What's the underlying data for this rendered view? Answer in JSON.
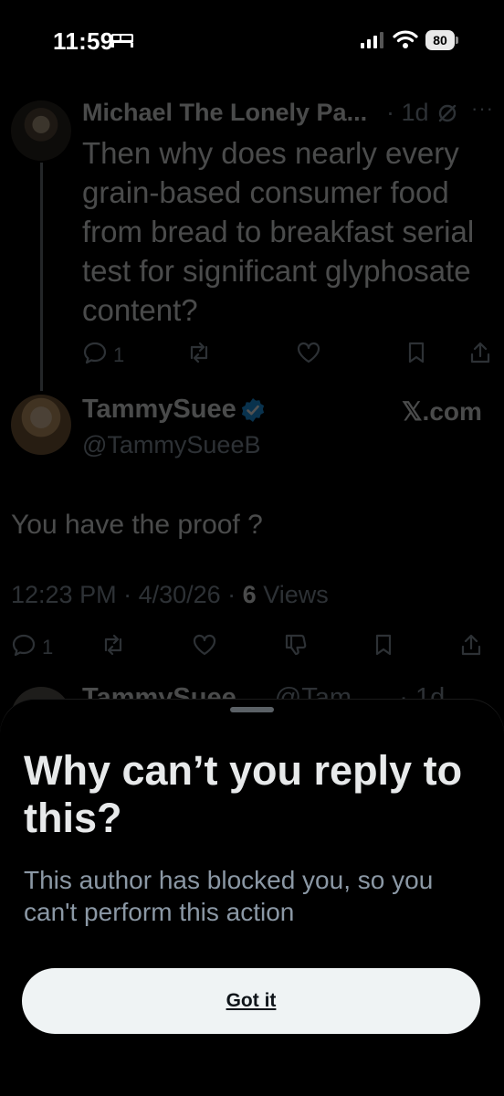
{
  "status_bar": {
    "time": "11:59",
    "battery": "80",
    "icons": [
      "bed-icon",
      "cellular-signal-icon",
      "wifi-icon",
      "battery-icon"
    ]
  },
  "parent_tweet": {
    "author": "Michael The Lonely Pa...",
    "meta": "· 1d",
    "text": "Then why does nearly every grain-based consumer food from bread to breakfast serial test for significant glyphosate content?",
    "reply_count": "1",
    "icons": [
      "grok-icon",
      "more-icon",
      "reply-icon",
      "repost-icon",
      "like-icon",
      "bookmark-icon",
      "share-icon"
    ]
  },
  "main_tweet": {
    "author": "TammySuee",
    "handle": "@TammySueeB",
    "brand": "𝕏.com",
    "text": "You have the proof ?",
    "time": "12:23 PM",
    "date": "4/30/26",
    "views_count": "6",
    "views_label": "Views",
    "reply_count": "1",
    "icons": [
      "verified-icon",
      "reply-icon",
      "repost-icon",
      "like-icon",
      "dislike-icon",
      "bookmark-icon",
      "share-icon"
    ]
  },
  "next_tweet": {
    "author": "TammySuee",
    "handle": "@Tam...",
    "meta": "· 1d"
  },
  "sheet": {
    "title": "Why can’t you reply to this?",
    "message": "This author has blocked you, so you can't perform this action",
    "button_label": "Got it"
  },
  "colors": {
    "background": "#000000",
    "text": "#e7e9ea",
    "muted": "#8b98a5",
    "verified": "#1d9bf0",
    "button": "#eff3f4"
  }
}
